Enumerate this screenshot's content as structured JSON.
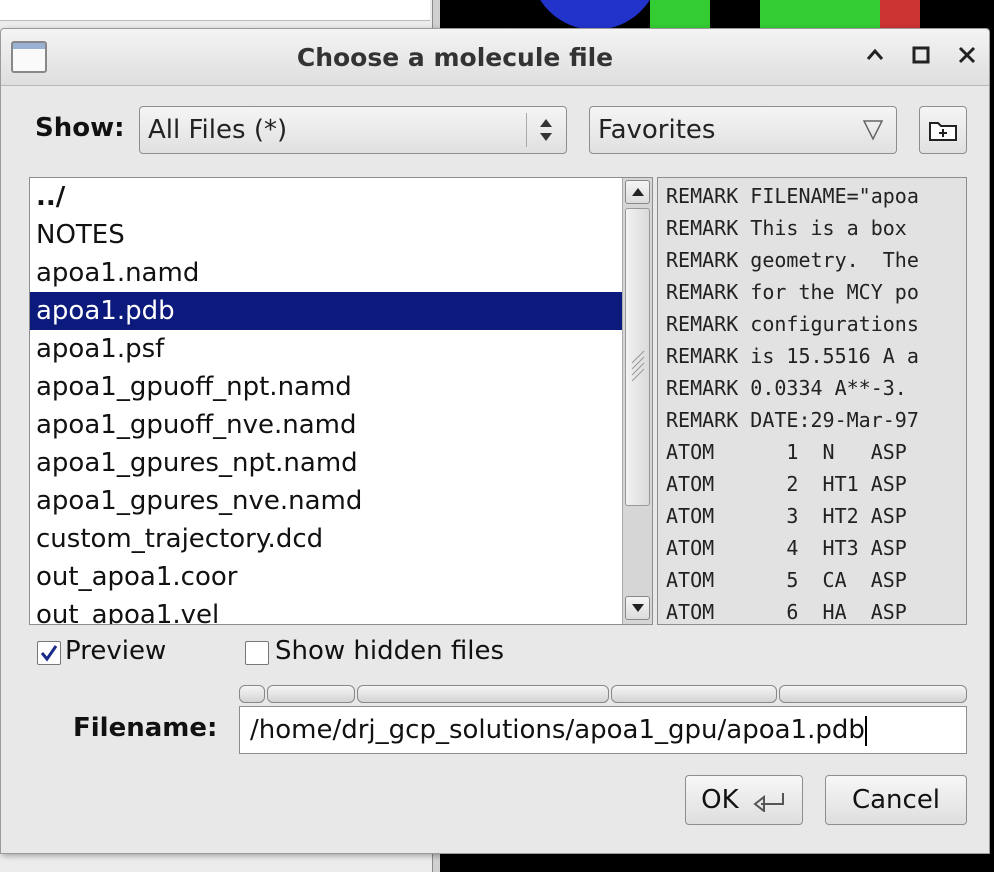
{
  "dialog": {
    "title": "Choose a molecule file",
    "controls": {
      "minimize": "^",
      "maximize": "□",
      "close": "✕"
    }
  },
  "filter": {
    "show_label": "Show:",
    "selected": "All Files (*)",
    "favorites": "Favorites"
  },
  "file_list": {
    "items": [
      "../",
      "NOTES",
      "apoa1.namd",
      "apoa1.pdb",
      "apoa1.psf",
      "apoa1_gpuoff_npt.namd",
      "apoa1_gpuoff_nve.namd",
      "apoa1_gpures_npt.namd",
      "apoa1_gpures_nve.namd",
      "custom_trajectory.dcd",
      "out_apoa1.coor",
      "out_apoa1.vel"
    ],
    "selected": "apoa1.pdb"
  },
  "preview": {
    "lines": [
      "REMARK FILENAME=\"apoa",
      "REMARK This is a box",
      "REMARK geometry.  The",
      "REMARK for the MCY po",
      "REMARK configurations",
      "REMARK is 15.5516 A a",
      "REMARK 0.0334 A**-3.",
      "REMARK DATE:29-Mar-97",
      "ATOM      1  N   ASP",
      "ATOM      2  HT1 ASP",
      "ATOM      3  HT2 ASP",
      "ATOM      4  HT3 ASP",
      "ATOM      5  CA  ASP",
      "ATOM      6  HA  ASP"
    ]
  },
  "options": {
    "preview_label": "Preview",
    "preview_checked": true,
    "hidden_label": "Show hidden files",
    "hidden_checked": false
  },
  "filename": {
    "label": "Filename:",
    "value": "/home/drj_gcp_solutions/apoa1_gpu/apoa1.pdb"
  },
  "buttons": {
    "ok": "OK",
    "cancel": "Cancel"
  },
  "icons": {
    "window": "window-icon",
    "combo_arrows": "up-down-arrows-icon",
    "favorites_arrow": "triangle-down-icon",
    "new_folder": "new-folder-icon",
    "enter": "return-key-icon"
  }
}
